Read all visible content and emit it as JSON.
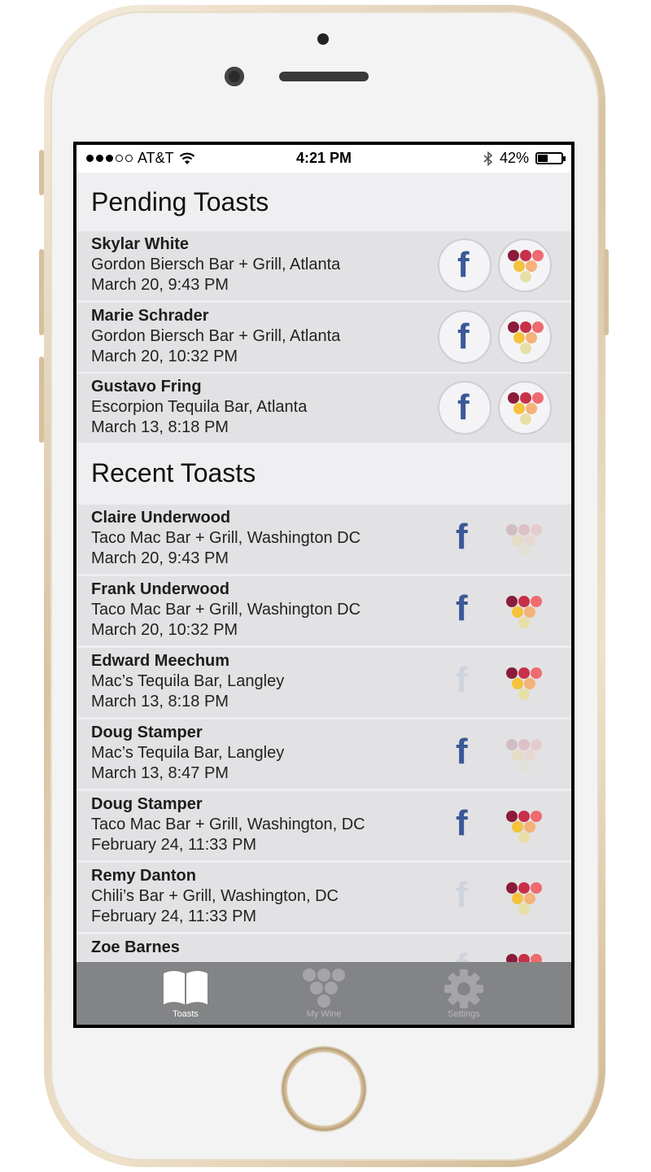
{
  "status_bar": {
    "carrier": "AT&T",
    "time": "4:21 PM",
    "battery": "42%",
    "signal_bars_filled": 3,
    "signal_bars_total": 5
  },
  "pending": {
    "title": "Pending Toasts",
    "items": [
      {
        "name": "Skylar White",
        "place": "Gordon Biersch Bar + Grill, Atlanta",
        "date": "March 20, 9:43 PM"
      },
      {
        "name": "Marie Schrader",
        "place": "Gordon Biersch Bar + Grill, Atlanta",
        "date": "March 20, 10:32 PM"
      },
      {
        "name": "Gustavo Fring",
        "place": "Escorpion Tequila Bar, Atlanta",
        "date": "March 13, 8:18 PM"
      }
    ]
  },
  "recent": {
    "title": "Recent Toasts",
    "items": [
      {
        "name": "Claire Underwood",
        "place": "Taco Mac Bar + Grill, Washington DC",
        "date": "March 20, 9:43 PM",
        "facebook_active": true,
        "wine_active": false
      },
      {
        "name": "Frank Underwood",
        "place": "Taco Mac Bar + Grill, Washington DC",
        "date": "March 20, 10:32 PM",
        "facebook_active": true,
        "wine_active": true
      },
      {
        "name": "Edward Meechum",
        "place": "Mac’s Tequila Bar, Langley",
        "date": "March 13, 8:18 PM",
        "facebook_active": false,
        "wine_active": true
      },
      {
        "name": "Doug Stamper",
        "place": "Mac’s Tequila Bar, Langley",
        "date": "March 13, 8:47 PM",
        "facebook_active": true,
        "wine_active": false
      },
      {
        "name": "Doug Stamper",
        "place": "Taco Mac Bar + Grill, Washington, DC",
        "date": "February 24, 11:33 PM",
        "facebook_active": true,
        "wine_active": true
      },
      {
        "name": "Remy Danton",
        "place": "Chili’s Bar + Grill, Washington, DC",
        "date": "February 24, 11:33 PM",
        "facebook_active": false,
        "wine_active": true
      },
      {
        "name": "Zoe Barnes",
        "place": "",
        "date": "",
        "facebook_active": false,
        "wine_active": true
      }
    ]
  },
  "tabbar": {
    "tabs": [
      {
        "label": "Toasts",
        "icon": "book-icon",
        "active": true
      },
      {
        "label": "My Wine",
        "icon": "grapes-icon",
        "active": false
      },
      {
        "label": "Settings",
        "icon": "gear-icon",
        "active": false
      }
    ]
  },
  "colors": {
    "facebook": "#3b5998",
    "grape_dark": "#8a1c3a",
    "grape_mid": "#c8304a",
    "grape_pink": "#ee6b70",
    "grape_yellow": "#f5c23a",
    "grape_peach": "#f5b27a",
    "grape_pale": "#e6e0a8"
  }
}
